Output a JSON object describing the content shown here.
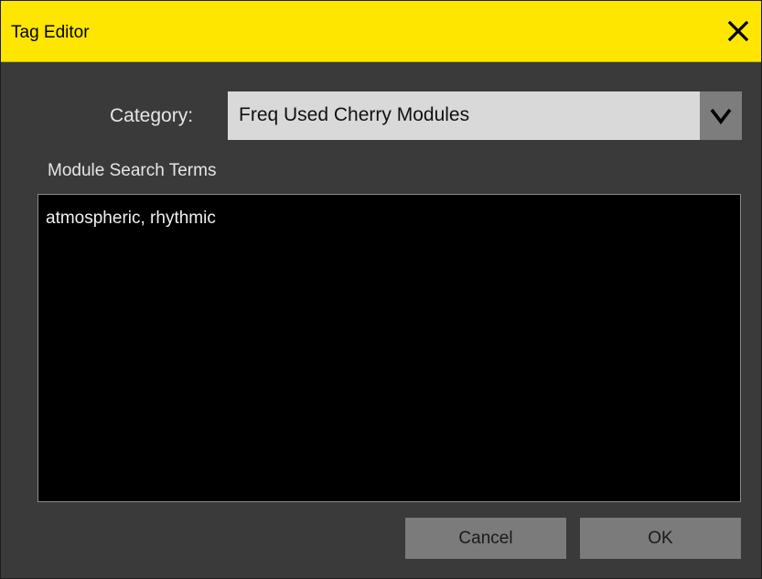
{
  "dialog": {
    "title": "Tag Editor",
    "close_icon": "close-icon"
  },
  "category": {
    "label": "Category:",
    "selected": "Freq Used Cherry Modules",
    "dropdown_icon": "chevron-down-icon"
  },
  "search_terms": {
    "label": "Module Search Terms",
    "value": "atmospheric, rhythmic"
  },
  "buttons": {
    "cancel": "Cancel",
    "ok": "OK"
  },
  "colors": {
    "titlebar": "#ffe600",
    "background": "#3a3a3a",
    "textarea": "#000000",
    "button": "#7b7b7b"
  }
}
